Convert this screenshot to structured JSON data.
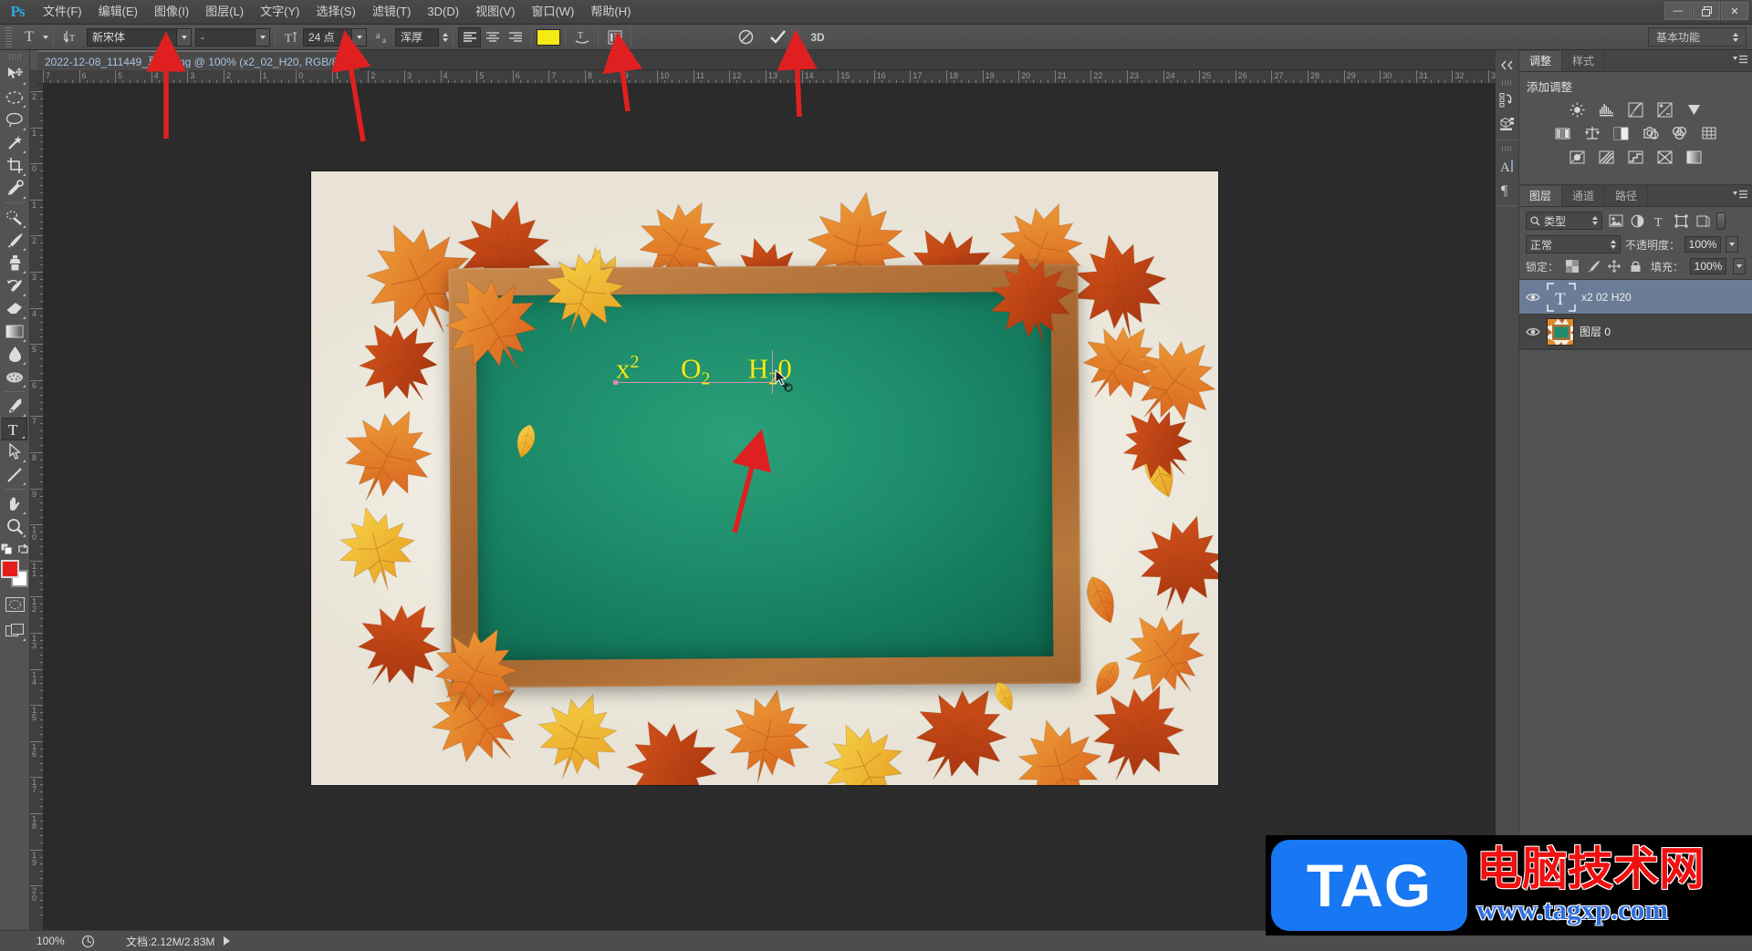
{
  "app": {
    "name": "Adobe Photoshop",
    "logo_text": "Ps"
  },
  "menubar": {
    "items": [
      {
        "label": "文件(F)",
        "name": "menu-file"
      },
      {
        "label": "编辑(E)",
        "name": "menu-edit"
      },
      {
        "label": "图像(I)",
        "name": "menu-image"
      },
      {
        "label": "图层(L)",
        "name": "menu-layer"
      },
      {
        "label": "文字(Y)",
        "name": "menu-type"
      },
      {
        "label": "选择(S)",
        "name": "menu-select"
      },
      {
        "label": "滤镜(T)",
        "name": "menu-filter"
      },
      {
        "label": "3D(D)",
        "name": "menu-3d"
      },
      {
        "label": "视图(V)",
        "name": "menu-view"
      },
      {
        "label": "窗口(W)",
        "name": "menu-window"
      },
      {
        "label": "帮助(H)",
        "name": "menu-help"
      }
    ],
    "window_controls": {
      "minimize": "—",
      "restore": "❐",
      "close": "✕"
    }
  },
  "options_bar": {
    "tool_preset_icon": "type-tool-icon",
    "orientation_icon": "text-orientation-icon",
    "font_family": "新宋体",
    "font_style": "-",
    "font_size": "24 点",
    "size_icon": "font-size-icon",
    "antialias_icon": "anti-alias-icon",
    "antialias_value": "浑厚",
    "align_left_icon": "align-left-icon",
    "align_center_icon": "align-center-icon",
    "align_right_icon": "align-right-icon",
    "text_color": "#f5e916",
    "warp_icon": "warp-text-icon",
    "panels_icon": "character-paragraph-panels-icon",
    "cancel_icon": "cancel-icon",
    "commit_icon": "commit-checkmark-icon",
    "threed_label": "3D",
    "workspace": "基本功能"
  },
  "document": {
    "tab_title": "2022-12-08_111449_夏和.png @ 100% (x2_02_H20, RGB/8)",
    "close_glyph": "×",
    "zoom": "100%",
    "color_mode": "RGB/8"
  },
  "rulers": {
    "unit": "cm",
    "horizontal_ticks": [
      "7",
      "6",
      "5",
      "4",
      "3",
      "2",
      "1",
      "0",
      "1",
      "2",
      "3",
      "4",
      "5",
      "6",
      "7",
      "8",
      "9",
      "10",
      "11",
      "12",
      "13",
      "14",
      "15",
      "16",
      "17",
      "18",
      "19",
      "20",
      "21",
      "22",
      "23",
      "24",
      "25",
      "26",
      "27",
      "28",
      "29",
      "30",
      "31",
      "32",
      "33"
    ],
    "vertical_ticks": [
      "2",
      "1",
      "0",
      "1",
      "2",
      "3",
      "4",
      "5",
      "6",
      "7",
      "8",
      "9",
      "1 0",
      "1 1",
      "1 2",
      "1 3",
      "1 4",
      "1 5",
      "1 6",
      "1 7",
      "1 8",
      "1 9",
      "2 0"
    ]
  },
  "toolbar": {
    "tools": [
      {
        "name": "move-tool",
        "label": "移动工具",
        "selected": false
      },
      {
        "name": "marquee-tool",
        "label": "选框工具",
        "selected": false
      },
      {
        "name": "lasso-tool",
        "label": "套索工具",
        "selected": false
      },
      {
        "name": "magic-wand-tool",
        "label": "魔棒工具",
        "selected": false
      },
      {
        "name": "crop-tool",
        "label": "裁剪工具",
        "selected": false
      },
      {
        "name": "eyedropper-tool",
        "label": "吸管工具",
        "selected": false
      },
      {
        "name": "healing-brush-tool",
        "label": "污点修复画笔",
        "selected": false
      },
      {
        "name": "brush-tool",
        "label": "画笔工具",
        "selected": false
      },
      {
        "name": "clone-stamp-tool",
        "label": "仿制图章工具",
        "selected": false
      },
      {
        "name": "history-brush-tool",
        "label": "历史记录画笔",
        "selected": false
      },
      {
        "name": "eraser-tool",
        "label": "橡皮擦工具",
        "selected": false
      },
      {
        "name": "gradient-tool",
        "label": "渐变工具",
        "selected": false
      },
      {
        "name": "blur-tool",
        "label": "模糊工具",
        "selected": false
      },
      {
        "name": "dodge-tool",
        "label": "减淡工具",
        "selected": false
      },
      {
        "name": "pen-tool",
        "label": "钢笔工具",
        "selected": false
      },
      {
        "name": "type-tool",
        "label": "横排文字工具",
        "selected": true
      },
      {
        "name": "path-selection-tool",
        "label": "路径选择工具",
        "selected": false
      },
      {
        "name": "line-shape-tool",
        "label": "直线工具",
        "selected": false
      },
      {
        "name": "hand-tool",
        "label": "抓手工具",
        "selected": false
      },
      {
        "name": "zoom-tool",
        "label": "缩放工具",
        "selected": false
      }
    ],
    "foreground_color": "#e81c1c",
    "background_color": "#ffffff",
    "quickmask_icon": "quick-mask-icon",
    "screenmode_icon": "screen-mode-icon",
    "swap_icon": "swap-colors-icon",
    "default_icon": "default-colors-icon"
  },
  "canvas": {
    "artwork_description": "autumn-leaves-chalkboard",
    "chalkboard_color": "#1d8d6b",
    "frame_color": "#b3733a",
    "text_layer_value": "x2 02 H20",
    "rendered_equation": {
      "base": "x",
      "superscript": "2",
      "parts": [
        "x",
        "2",
        "O",
        "2",
        "H",
        "2",
        "0"
      ],
      "display": "x²   O₂   H₂0",
      "color": "#f5e916",
      "font_size_pt": "24 点"
    },
    "baseline_color": "#d98fb5",
    "cursor_icon": "text-cursor-icon"
  },
  "annotations": {
    "color": "#e02020",
    "arrows": [
      {
        "name": "arrow-to-font-family",
        "desc": "指向字体选择"
      },
      {
        "name": "arrow-to-font-size",
        "desc": "指向字号"
      },
      {
        "name": "arrow-to-text-color",
        "desc": "指向文字颜色"
      },
      {
        "name": "arrow-to-commit",
        "desc": "指向提交按钮"
      },
      {
        "name": "arrow-to-canvas-text",
        "desc": "指向画布文字"
      }
    ]
  },
  "dock_strip": {
    "icons": [
      {
        "name": "history-panel-icon",
        "label": "历史记录"
      },
      {
        "name": "3d-panel-icon",
        "label": "3D"
      },
      {
        "name": "character-panel-icon",
        "label": "字符"
      },
      {
        "name": "paragraph-panel-icon",
        "label": "段落"
      }
    ],
    "collapse_icon": "collapse-panels-icon"
  },
  "adjustments_panel": {
    "tabs": [
      {
        "label": "调整",
        "active": true,
        "name": "tab-adjustments"
      },
      {
        "label": "样式",
        "active": false,
        "name": "tab-styles"
      }
    ],
    "title": "添加调整",
    "menu_icon": "panel-menu-icon",
    "buttons": [
      [
        {
          "name": "adj-brightness-contrast-icon",
          "label": "亮度/对比度"
        },
        {
          "name": "adj-levels-icon",
          "label": "色阶"
        },
        {
          "name": "adj-curves-icon",
          "label": "曲线"
        },
        {
          "name": "adj-exposure-icon",
          "label": "曝光度"
        },
        {
          "name": "adj-vibrance-icon",
          "label": "自然饱和度"
        }
      ],
      [
        {
          "name": "adj-hue-saturation-icon",
          "label": "色相/饱和度"
        },
        {
          "name": "adj-color-balance-icon",
          "label": "色彩平衡"
        },
        {
          "name": "adj-black-white-icon",
          "label": "黑白"
        },
        {
          "name": "adj-photo-filter-icon",
          "label": "照片滤镜"
        },
        {
          "name": "adj-channel-mixer-icon",
          "label": "通道混合器"
        },
        {
          "name": "adj-color-lookup-icon",
          "label": "颜色查找"
        }
      ],
      [
        {
          "name": "adj-invert-icon",
          "label": "反相"
        },
        {
          "name": "adj-posterize-icon",
          "label": "色调分离"
        },
        {
          "name": "adj-threshold-icon",
          "label": "阈值"
        },
        {
          "name": "adj-gradient-map-icon",
          "label": "渐变映射"
        },
        {
          "name": "adj-selective-color-icon",
          "label": "可选颜色"
        }
      ]
    ]
  },
  "layers_panel": {
    "tabs": [
      {
        "label": "图层",
        "active": true,
        "name": "tab-layers"
      },
      {
        "label": "通道",
        "active": false,
        "name": "tab-channels"
      },
      {
        "label": "路径",
        "active": false,
        "name": "tab-paths"
      }
    ],
    "menu_icon": "panel-menu-icon",
    "filter": {
      "search_icon": "search-icon",
      "type_label": "类型",
      "icons": [
        {
          "name": "filter-pixel-icon",
          "label": "像素图层"
        },
        {
          "name": "filter-adjustment-icon",
          "label": "调整图层"
        },
        {
          "name": "filter-type-icon",
          "label": "文字图层"
        },
        {
          "name": "filter-shape-icon",
          "label": "形状图层"
        },
        {
          "name": "filter-smartobject-icon",
          "label": "智能对象"
        }
      ]
    },
    "blend_mode": "正常",
    "opacity_label": "不透明度：",
    "opacity_value": "100%",
    "lock_label": "锁定：",
    "lock_icons": [
      {
        "name": "lock-transparency-icon",
        "label": "锁定透明像素"
      },
      {
        "name": "lock-image-icon",
        "label": "锁定图像像素"
      },
      {
        "name": "lock-position-icon",
        "label": "锁定位置"
      },
      {
        "name": "lock-all-icon",
        "label": "锁定全部"
      }
    ],
    "fill_label": "填充：",
    "fill_value": "100%",
    "layers": [
      {
        "name": "layer-row-text",
        "title": "x2 02 H20",
        "kind": "type",
        "selected": true,
        "visible": true,
        "thumb_glyph": "T"
      },
      {
        "name": "layer-row-background",
        "title": "图层 0",
        "kind": "image",
        "selected": false,
        "visible": true,
        "thumb_glyph": ""
      }
    ]
  },
  "status_bar": {
    "zoom": "100%",
    "scrubby_icon": "scrubby-zoom-icon",
    "doc_info": "文档:2.12M/2.83M",
    "arrow_icon": "status-expand-icon"
  },
  "watermark": {
    "badge": "TAG",
    "site_name": "电脑技术网",
    "url": "www.tagxp.com",
    "badge_color": "#1877f2",
    "site_color": "#f01010",
    "url_color": "#2f6fe0"
  }
}
